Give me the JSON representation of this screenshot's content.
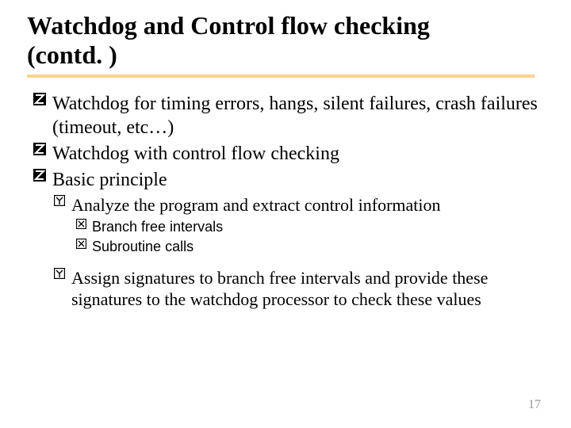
{
  "title_line1": "Watchdog and Control flow checking",
  "title_line2": "(contd. )",
  "bullets": {
    "b1": "Watchdog for timing errors, hangs, silent failures, crash failures (timeout, etc…)",
    "b2": "Watchdog with control flow checking",
    "b3": "Basic principle",
    "b3a": "Analyze the program and extract control information",
    "b3a1": "Branch free intervals",
    "b3a2": "Subroutine calls",
    "b3b": "Assign signatures to branch free intervals and provide these signatures to the watchdog processor to check these values"
  },
  "page_number": "17"
}
